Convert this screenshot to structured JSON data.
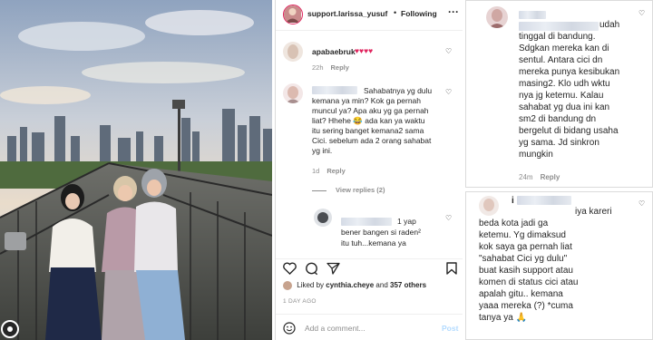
{
  "header": {
    "username": "support.larissa_yusuf",
    "separator": "•",
    "follow_label": "Following",
    "more_icon": "more-dots-icon"
  },
  "comments": [
    {
      "user": "apabaebruk",
      "text": "♥♥♥♥",
      "age": "22h",
      "reply": "Reply"
    },
    {
      "user_redacted": true,
      "lines": [
        "Sahabatnya yg dulu",
        "kemana ya min? Kok ga pernah",
        "muncul ya? Apa aku yg ga pernah",
        "liat? Hhehe 😂 ada kan ya waktu",
        "itu sering banget kemana2 sama",
        "Cici. sebelum ada 2 orang sahabat",
        "yg ini."
      ],
      "age": "1d",
      "reply": "Reply"
    }
  ],
  "view_replies": "View replies (2)",
  "nested_reply": {
    "lines": [
      "1 yap",
      "bener bangen si raden²",
      "itu tuh...kemana ya"
    ]
  },
  "actions": {
    "like": "heart-outline-icon",
    "comment": "comment-bubble-icon",
    "share": "paper-plane-icon",
    "save": "bookmark-icon"
  },
  "likes": {
    "prefix": "Liked by",
    "user": "cynthia.cheye",
    "and": "and",
    "others": "357 others"
  },
  "date": "1 DAY AGO",
  "add_comment": {
    "placeholder": "Add a comment...",
    "post_label": "Post"
  },
  "crop1": {
    "lines": [
      "udah",
      "tinggal di bandung.",
      "Sdgkan mereka kan di",
      "sentul. Antara cici dn",
      "mereka punya kesibukan",
      "masing2. Klo udh wktu",
      "nya jg ketemu. Kalau",
      "sahabat yg dua ini kan",
      "sm2 di bandung dn",
      "bergelut di bidang usaha",
      "yg sama. Jd sinkron",
      "mungkin"
    ],
    "age": "24m",
    "reply": "Reply"
  },
  "crop2": {
    "first_user_initial": "i",
    "lines": [
      "iya kareri",
      "beda kota jadi ga",
      "ketemu. Yg dimaksud",
      "kok saya ga pernah liat",
      "\"sahabat Cici yg dulu\"",
      "buat kasih support atau",
      "komen di status cici atau",
      "apalah gitu.. kemana",
      "yaaa mereka (?) *cuma",
      "tanya ya 🙏"
    ]
  },
  "colors": {
    "accent_red": "#e0245e",
    "muted": "#8e8e8e",
    "post_disabled": "#b3dbff"
  }
}
